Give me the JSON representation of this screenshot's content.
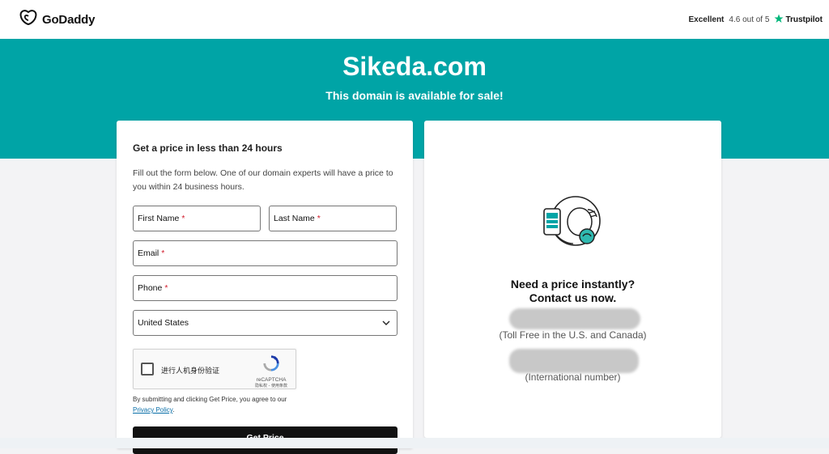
{
  "header": {
    "logo_text": "GoDaddy",
    "rating_label": "Excellent",
    "rating_score": "4.6 out of 5",
    "trustpilot_label": "Trustpilot"
  },
  "hero": {
    "domain": "Sikeda.com",
    "subtitle": "This domain is available for sale!",
    "background_color": "#00a4a6"
  },
  "form": {
    "title": "Get a price in less than 24 hours",
    "description": "Fill out the form below. One of our domain experts will have a price to you within 24 business hours.",
    "first_name_label": "First Name",
    "last_name_label": "Last Name",
    "email_label": "Email",
    "phone_label": "Phone",
    "required_mark": "*",
    "country_value": "United States",
    "captcha_label": "进行人机身份验证",
    "captcha_brand": "reCAPTCHA",
    "captcha_links": "隐私权 - 使用条款",
    "terms_text": "By submitting and clicking Get Price, you agree to our",
    "privacy_link": "Privacy Policy",
    "terms_end": ".",
    "submit_label": "Get Price"
  },
  "contact": {
    "heading_line1": "Need a price instantly?",
    "heading_line2": "Contact us now.",
    "tollfree_note": "(Toll Free in the U.S. and Canada)",
    "international_note": "(International number)"
  },
  "icons": {
    "logo": "godaddy-logo-icon",
    "trustpilot": "star-icon",
    "dropdown": "chevron-down-icon",
    "captcha": "recaptcha-icon",
    "illustration": "phone-support-illustration"
  }
}
